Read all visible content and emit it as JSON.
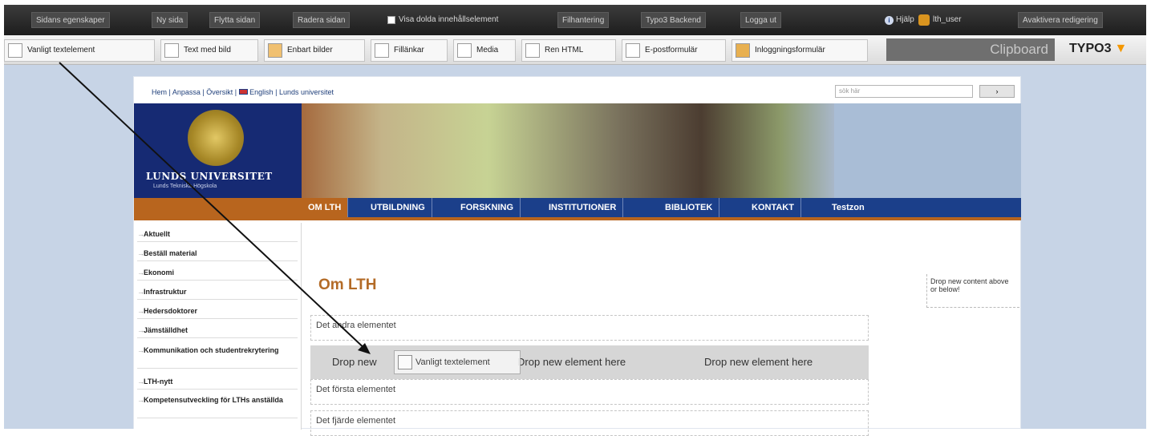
{
  "topbar": {
    "buttons": [
      "Sidans egenskaper",
      "Ny sida",
      "Flytta sidan",
      "Radera sidan"
    ],
    "checkbox_label": "Visa dolda innehållselement",
    "buttons2": [
      "Filhantering",
      "Typo3 Backend",
      "Logga ut"
    ],
    "help": "Hjälp",
    "user": "lth_user",
    "deactivate": "Avaktivera redigering"
  },
  "elements_toolbar": {
    "items": [
      "Vanligt textelement",
      "Text med bild",
      "Enbart bilder",
      "Fillänkar",
      "Media",
      "Ren HTML",
      "E-postformulär",
      "Inloggningsformulär"
    ],
    "clipboard": "Clipboard",
    "brand": "TYPO3"
  },
  "site": {
    "topnav": [
      "Hem",
      "Anpassa",
      "Översikt",
      "English",
      "Lunds universitet"
    ],
    "search_placeholder": "sök här",
    "search_button": "›",
    "university": "LUNDS UNIVERSITET",
    "faculty": "Lunds Tekniska Högskola",
    "mainnav": [
      "OM LTH",
      "UTBILDNING",
      "FORSKNING",
      "INSTITUTIONER",
      "BIBLIOTEK",
      "KONTAKT",
      "Testzon"
    ],
    "sidebar": [
      "Aktuellt",
      "Beställ material",
      "Ekonomi",
      "Infrastruktur",
      "Hedersdoktorer",
      "Jämställdhet",
      "Kommunikation och studentrekrytering",
      "LTH-nytt",
      "Kompetensutveckling för LTHs anställda"
    ],
    "page_title": "Om LTH",
    "content_elements": [
      "Det andra elementet",
      "Det första elementet",
      "Det fjärde elementet"
    ],
    "drop_label": "Drop new element here",
    "drop_label_cut": "Drop new",
    "drag_label": "Vanligt textelement",
    "right_drop": "Drop new content above or below!"
  }
}
